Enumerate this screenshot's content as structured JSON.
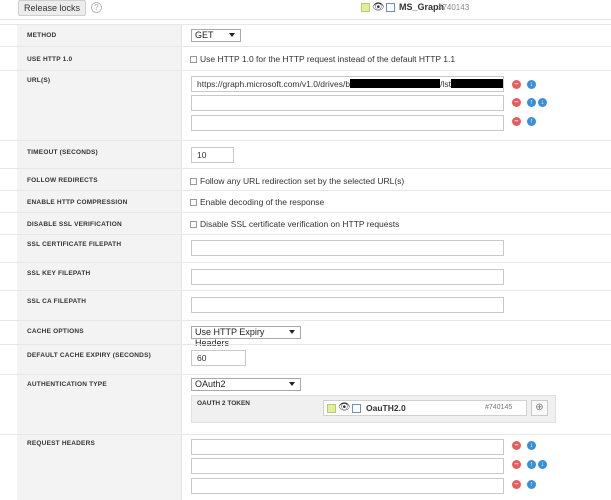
{
  "toolbar": {
    "release_locks_label": "Release locks",
    "help_icon": "?",
    "object_name": "MS_Graph",
    "object_id": "#740143"
  },
  "fields": {
    "method": {
      "label": "METHOD",
      "value": "GET"
    },
    "use_http10": {
      "label": "USE HTTP 1.0",
      "checkbox_text": "Use HTTP 1.0 for the HTTP request instead of the default HTTP 1.1",
      "checked": false
    },
    "urls": {
      "label": "URL(S)",
      "values": [
        "https://graph.microsoft.com/v1.0/drives/b",
        "",
        ""
      ],
      "value_suffix_1": "/lst",
      "value_suffix_2": "T"
    },
    "timeout": {
      "label": "TIMEOUT (SECONDS)",
      "value": "10"
    },
    "follow_redirects": {
      "label": "FOLLOW REDIRECTS",
      "checkbox_text": "Follow any URL redirection set by the selected URL(s)",
      "checked": false
    },
    "http_compression": {
      "label": "ENABLE HTTP COMPRESSION",
      "checkbox_text": "Enable decoding of the response",
      "checked": false
    },
    "ssl_verification": {
      "label": "DISABLE SSL VERIFICATION",
      "checkbox_text": "Disable SSL certificate verification on HTTP requests",
      "checked": false
    },
    "ssl_cert": {
      "label": "SSL CERTIFICATE FILEPATH",
      "value": ""
    },
    "ssl_key": {
      "label": "SSL KEY FILEPATH",
      "value": ""
    },
    "ssl_ca": {
      "label": "SSL CA FILEPATH",
      "value": ""
    },
    "cache_options": {
      "label": "CACHE OPTIONS",
      "value": "Use HTTP Expiry Headers"
    },
    "cache_expiry": {
      "label": "DEFAULT CACHE EXPIRY (SECONDS)",
      "value": "60"
    },
    "auth_type": {
      "label": "AUTHENTICATION TYPE",
      "value": "OAuth2"
    },
    "oauth_token": {
      "label": "OAUTH 2 TOKEN",
      "name": "OauTH2.0",
      "id": "#740145"
    },
    "request_headers": {
      "label": "REQUEST HEADERS",
      "values": [
        "",
        "",
        ""
      ]
    }
  },
  "colors": {
    "accent_blue": "#3a8fd9",
    "remove_red": "#e35d5d",
    "label_bg": "#f3f3f3",
    "object_square": "#dff09a"
  },
  "icons": {
    "object_type": "binoculars-icon",
    "object_lang": "code-file-icon",
    "remove": "minus-circle-icon",
    "move_down": "arrow-down-circle-icon",
    "move_up": "arrow-up-circle-icon",
    "target": "crosshair-icon"
  }
}
